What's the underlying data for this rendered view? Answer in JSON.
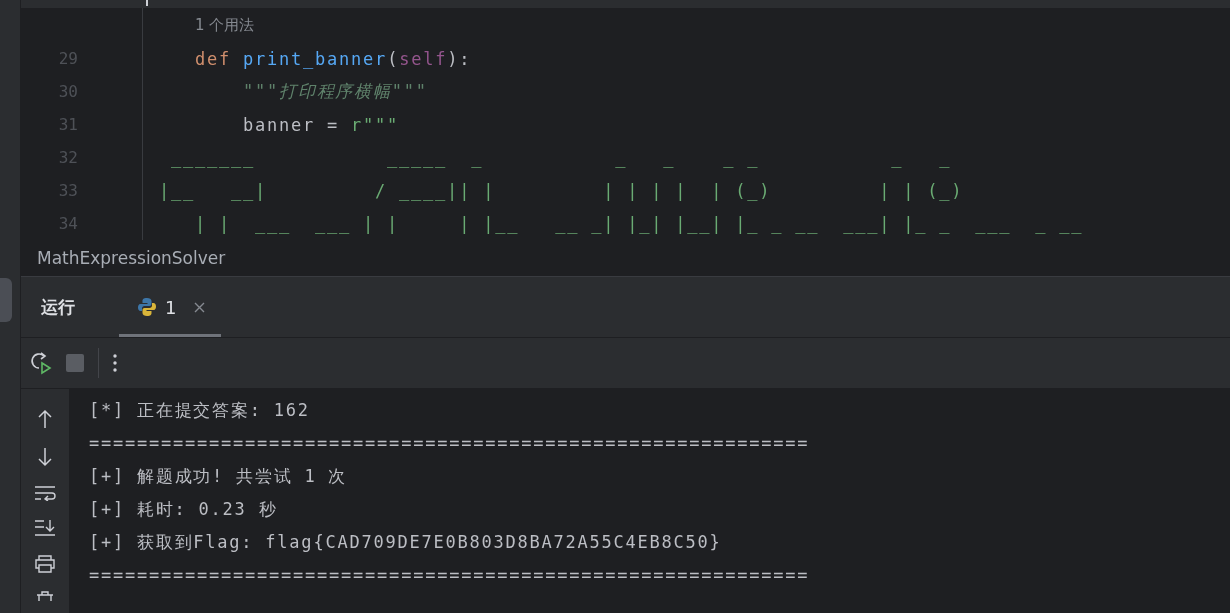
{
  "editor": {
    "lines": [
      {
        "kind": "hint",
        "text": "1 个用法"
      },
      {
        "number": "29",
        "kind": "code",
        "tokens": [
          {
            "kind": "keyword",
            "text": "    def"
          },
          {
            "kind": "function",
            "text": " print_banner"
          },
          {
            "kind": "plain",
            "text": "("
          },
          {
            "kind": "self",
            "text": "self"
          },
          {
            "kind": "plain",
            "text": "):"
          }
        ]
      },
      {
        "number": "30",
        "kind": "code",
        "tokens": [
          {
            "kind": "docstring",
            "text": "        \"\"\"打印程序横幅\"\"\""
          }
        ]
      },
      {
        "number": "31",
        "kind": "code",
        "tokens": [
          {
            "kind": "plain",
            "text": "        banner = "
          },
          {
            "kind": "string",
            "text": "r\"\"\""
          }
        ]
      },
      {
        "number": "32",
        "kind": "code",
        "tokens": [
          {
            "kind": "string",
            "text": "  _______           _____  _           _   _    _ _           _   _"
          }
        ]
      },
      {
        "number": "33",
        "kind": "code",
        "tokens": [
          {
            "kind": "string",
            "text": " |__   __|         / ____|| |         | | | |  | (_)         | | (_)"
          }
        ]
      },
      {
        "number": "34",
        "kind": "code",
        "tokens": [
          {
            "kind": "string",
            "text": "    | |  ___  ___ | |     | |__   __ _| |_| |__| |_ _ __  ___| |_ _  ___  _ __"
          }
        ]
      }
    ]
  },
  "breadcrumb": "MathExpressionSolver",
  "run_panel": {
    "title": "运行",
    "tabs": [
      {
        "label": "1",
        "selected": true
      }
    ]
  },
  "console": {
    "lines": [
      "[*] 正在提交答案: 162",
      "============================================================",
      "[+] 解题成功! 共尝试 1 次",
      "[+] 耗时: 0.23 秒",
      "[+] 获取到Flag: flag{CAD709DE7E0B803D8BA72A55C4EB8C50}",
      "============================================================"
    ]
  }
}
